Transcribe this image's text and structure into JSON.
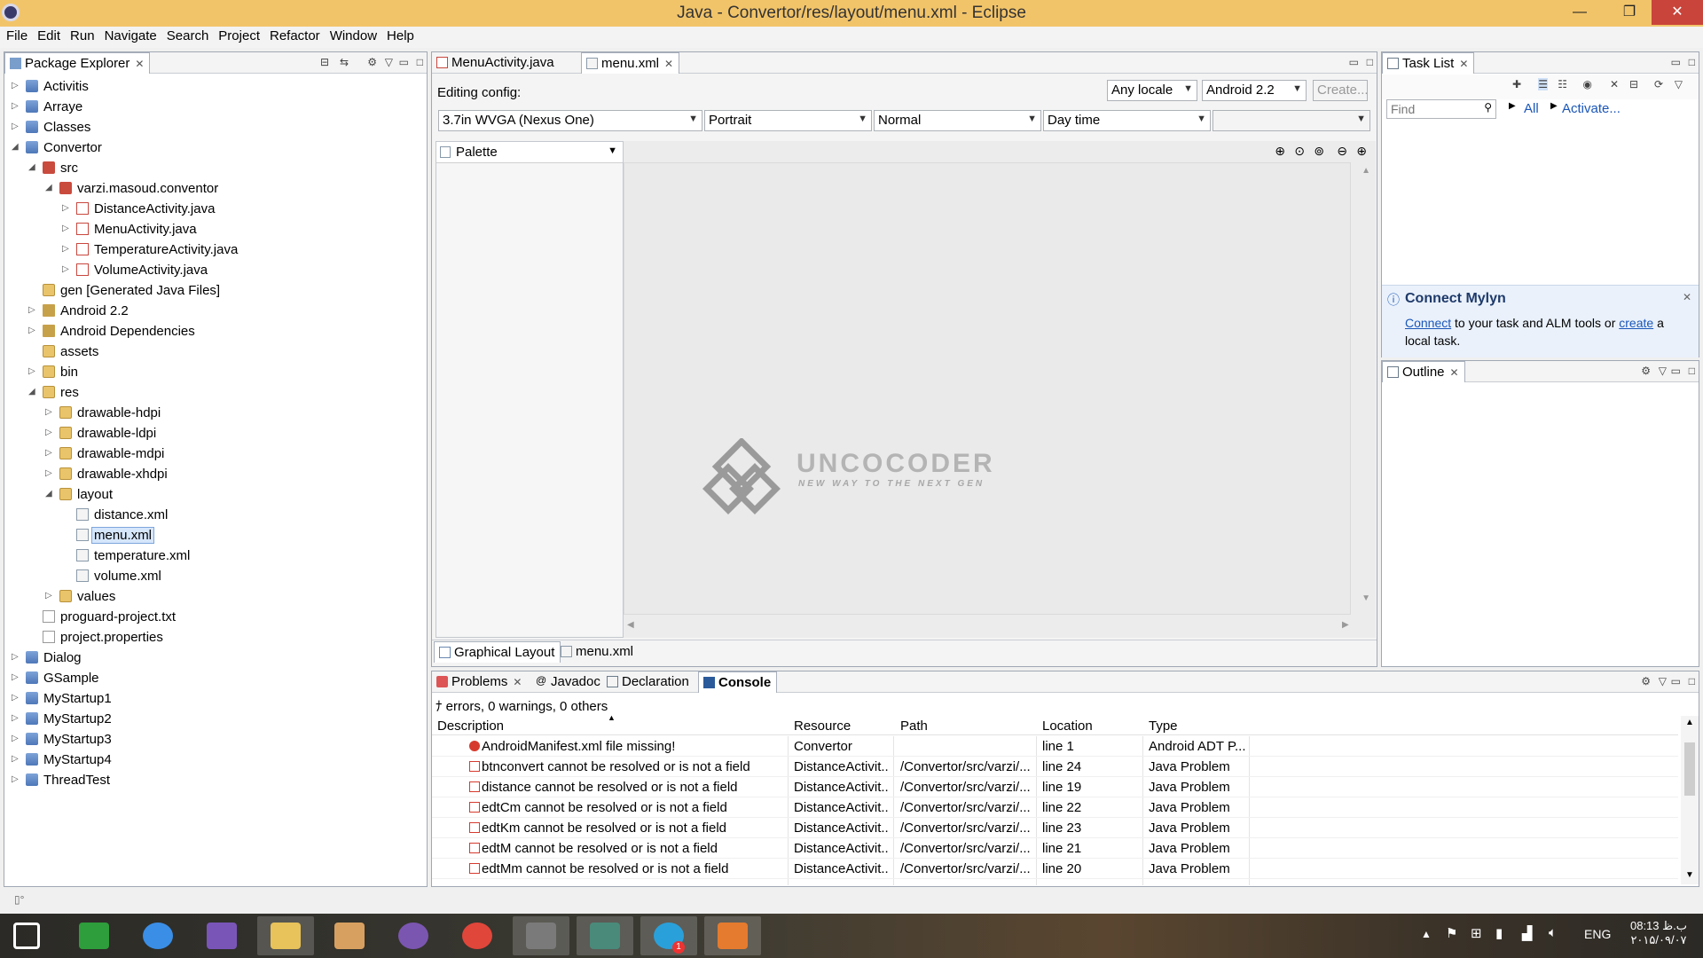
{
  "window": {
    "title": "Java - Convertor/res/layout/menu.xml - Eclipse",
    "minimize": "—",
    "maximize": "❐",
    "close": "✕"
  },
  "menu": [
    "File",
    "Edit",
    "Run",
    "Navigate",
    "Search",
    "Project",
    "Refactor",
    "Window",
    "Help"
  ],
  "package_explorer": {
    "title": "Package Explorer",
    "items": [
      {
        "label": "Activitis",
        "depth": 0,
        "arrow": "▷",
        "icon": "proj"
      },
      {
        "label": "Arraye",
        "depth": 0,
        "arrow": "▷",
        "icon": "proj"
      },
      {
        "label": "Classes",
        "depth": 0,
        "arrow": "▷",
        "icon": "proj"
      },
      {
        "label": "Convertor",
        "depth": 0,
        "arrow": "◢",
        "icon": "proj"
      },
      {
        "label": "src",
        "depth": 1,
        "arrow": "◢",
        "icon": "pkgf"
      },
      {
        "label": "varzi.masoud.conventor",
        "depth": 2,
        "arrow": "◢",
        "icon": "pkgf"
      },
      {
        "label": "DistanceActivity.java",
        "depth": 3,
        "arrow": "▷",
        "icon": "java"
      },
      {
        "label": "MenuActivity.java",
        "depth": 3,
        "arrow": "▷",
        "icon": "java"
      },
      {
        "label": "TemperatureActivity.java",
        "depth": 3,
        "arrow": "▷",
        "icon": "java"
      },
      {
        "label": "VolumeActivity.java",
        "depth": 3,
        "arrow": "▷",
        "icon": "java"
      },
      {
        "label": "gen [Generated Java Files]",
        "depth": 1,
        "arrow": "",
        "icon": "folder"
      },
      {
        "label": "Android 2.2",
        "depth": 1,
        "arrow": "▷",
        "icon": "lib"
      },
      {
        "label": "Android Dependencies",
        "depth": 1,
        "arrow": "▷",
        "icon": "lib"
      },
      {
        "label": "assets",
        "depth": 1,
        "arrow": "",
        "icon": "folder"
      },
      {
        "label": "bin",
        "depth": 1,
        "arrow": "▷",
        "icon": "folder"
      },
      {
        "label": "res",
        "depth": 1,
        "arrow": "◢",
        "icon": "folder"
      },
      {
        "label": "drawable-hdpi",
        "depth": 2,
        "arrow": "▷",
        "icon": "folder"
      },
      {
        "label": "drawable-ldpi",
        "depth": 2,
        "arrow": "▷",
        "icon": "folder"
      },
      {
        "label": "drawable-mdpi",
        "depth": 2,
        "arrow": "▷",
        "icon": "folder"
      },
      {
        "label": "drawable-xhdpi",
        "depth": 2,
        "arrow": "▷",
        "icon": "folder"
      },
      {
        "label": "layout",
        "depth": 2,
        "arrow": "◢",
        "icon": "folder"
      },
      {
        "label": "distance.xml",
        "depth": 3,
        "arrow": "",
        "icon": "xml"
      },
      {
        "label": "menu.xml",
        "depth": 3,
        "arrow": "",
        "icon": "xml",
        "selected": true
      },
      {
        "label": "temperature.xml",
        "depth": 3,
        "arrow": "",
        "icon": "xml"
      },
      {
        "label": "volume.xml",
        "depth": 3,
        "arrow": "",
        "icon": "xml"
      },
      {
        "label": "values",
        "depth": 2,
        "arrow": "▷",
        "icon": "folder"
      },
      {
        "label": "proguard-project.txt",
        "depth": 1,
        "arrow": "",
        "icon": "txt"
      },
      {
        "label": "project.properties",
        "depth": 1,
        "arrow": "",
        "icon": "txt"
      },
      {
        "label": "Dialog",
        "depth": 0,
        "arrow": "▷",
        "icon": "proj"
      },
      {
        "label": "GSample",
        "depth": 0,
        "arrow": "▷",
        "icon": "proj"
      },
      {
        "label": "MyStartup1",
        "depth": 0,
        "arrow": "▷",
        "icon": "proj"
      },
      {
        "label": "MyStartup2",
        "depth": 0,
        "arrow": "▷",
        "icon": "proj"
      },
      {
        "label": "MyStartup3",
        "depth": 0,
        "arrow": "▷",
        "icon": "proj"
      },
      {
        "label": "MyStartup4",
        "depth": 0,
        "arrow": "▷",
        "icon": "proj"
      },
      {
        "label": "ThreadTest",
        "depth": 0,
        "arrow": "▷",
        "icon": "proj"
      }
    ]
  },
  "editor": {
    "tabs": [
      "MenuActivity.java",
      "menu.xml"
    ],
    "editing_config_label": "Editing config:",
    "locale": "Any locale",
    "api": "Android 2.2",
    "create_btn": "Create...",
    "device": "3.7in WVGA (Nexus One)",
    "orientation": "Portrait",
    "mode": "Normal",
    "time": "Day time",
    "palette": "Palette",
    "bottom_tabs": [
      "Graphical Layout",
      "menu.xml"
    ],
    "watermark_title": "UNCOCODER",
    "watermark_sub": "NEW WAY TO THE NEXT GEN"
  },
  "task_list": {
    "title": "Task List",
    "find_placeholder": "Find",
    "all": "All",
    "activate": "Activate...",
    "mylyn_title": "Connect Mylyn",
    "mylyn_connect": "Connect",
    "mylyn_mid": " to your task and ALM tools or ",
    "mylyn_create": "create",
    "mylyn_tail": " a local task."
  },
  "outline": {
    "title": "Outline"
  },
  "problems": {
    "tabs": [
      "Problems",
      "Javadoc",
      "Declaration",
      "Console"
    ],
    "summary": "ﾅ errors, 0 warnings, 0 others",
    "columns": [
      "Description",
      "Resource",
      "Path",
      "Location",
      "Type"
    ],
    "rows": [
      {
        "icon": "error",
        "description": "AndroidManifest.xml file missing!",
        "resource": "Convertor",
        "path": "",
        "location": "line 1",
        "type": "Android ADT P..."
      },
      {
        "icon": "java-error",
        "description": "btnconvert cannot be resolved or is not a field",
        "resource": "DistanceActivit...",
        "path": "/Convertor/src/varzi/...",
        "location": "line 24",
        "type": "Java Problem"
      },
      {
        "icon": "java-error",
        "description": "distance cannot be resolved or is not a field",
        "resource": "DistanceActivit...",
        "path": "/Convertor/src/varzi/...",
        "location": "line 19",
        "type": "Java Problem"
      },
      {
        "icon": "java-error",
        "description": "edtCm cannot be resolved or is not a field",
        "resource": "DistanceActivit...",
        "path": "/Convertor/src/varzi/...",
        "location": "line 22",
        "type": "Java Problem"
      },
      {
        "icon": "java-error",
        "description": "edtKm cannot be resolved or is not a field",
        "resource": "DistanceActivit...",
        "path": "/Convertor/src/varzi/...",
        "location": "line 23",
        "type": "Java Problem"
      },
      {
        "icon": "java-error",
        "description": "edtM cannot be resolved or is not a field",
        "resource": "DistanceActivit...",
        "path": "/Convertor/src/varzi/...",
        "location": "line 21",
        "type": "Java Problem"
      },
      {
        "icon": "java-error",
        "description": "edtMm cannot be resolved or is not a field",
        "resource": "DistanceActivit...",
        "path": "/Convertor/src/varzi/...",
        "location": "line 20",
        "type": "Java Problem"
      }
    ]
  },
  "taskbar": {
    "apps": [
      "start",
      "store",
      "internet-explorer",
      "visual-studio",
      "file-explorer",
      "paint",
      "viber",
      "chrome",
      "settings-app",
      "windows-app",
      "telegram",
      "media-player"
    ],
    "telegram_badge": "1",
    "tray_lang": "ENG",
    "time": "08:13 ب.ظ",
    "date": "۲۰۱۵/۰۹/۰۷"
  },
  "colors": {
    "titlebar": "#f2c46a",
    "close_btn": "#c9443b",
    "selection": "#d6e6fb",
    "link": "#1a56b8"
  }
}
